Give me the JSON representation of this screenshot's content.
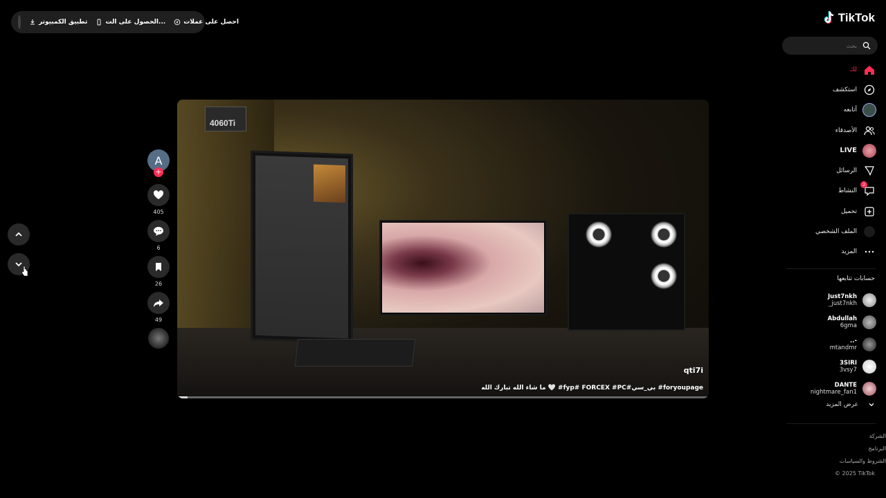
{
  "topbar": {
    "desktop_app": "تطبيق الكمبيوتر",
    "get_app": "الحصول على الت...",
    "get_coins": "احصل على عملات"
  },
  "brand": {
    "name": "TikTok"
  },
  "search": {
    "placeholder": "بحث"
  },
  "nav": [
    {
      "label": "لك",
      "icon": "home-icon",
      "active": true
    },
    {
      "label": "استكشف",
      "icon": "compass-icon"
    },
    {
      "label": "أتابعه",
      "icon": "following-icon"
    },
    {
      "label": "الأصدقاء",
      "icon": "friends-icon"
    },
    {
      "label": "LIVE",
      "icon": "live-icon"
    },
    {
      "label": "الرسائل",
      "icon": "messages-icon"
    },
    {
      "label": "النشاط",
      "icon": "activity-icon",
      "badge": "2"
    },
    {
      "label": "تحميل",
      "icon": "upload-icon"
    },
    {
      "label": "الملف الشخصي",
      "icon": "profile-icon"
    },
    {
      "label": "المزيد",
      "icon": "more-icon"
    }
  ],
  "following": {
    "title": "حسابات تتابعها",
    "accounts": [
      {
        "display": "Just7nkh",
        "handle": "_just7nkh"
      },
      {
        "display": "Abdullah",
        "handle": "6gma"
      },
      {
        "display": "..-",
        "handle": "mtandmr"
      },
      {
        "display": "3SIRI",
        "handle": "3vsy7"
      },
      {
        "display": "DANTE",
        "handle": "nightmare_fan1"
      }
    ],
    "see_more": "عرض المزيد"
  },
  "footer": {
    "company": "الشركة",
    "program": "البرنامج",
    "terms": "الشروط والسياسات",
    "copyright": "© 2025 TikTok"
  },
  "video": {
    "author": "qti7i",
    "caption": "ما شاء الله تبارك الله 🤍 #fyp# FORCEX #PC#بي_سي #foryoupage",
    "gpu_label": "4060Ti",
    "progress": 0.02
  },
  "actions": {
    "avatar_letter": "A",
    "follow_plus": "+",
    "likes": "405",
    "comments": "6",
    "saves": "26",
    "shares": "49"
  },
  "colors": {
    "accent": "#fe2c55",
    "background": "#000000"
  }
}
